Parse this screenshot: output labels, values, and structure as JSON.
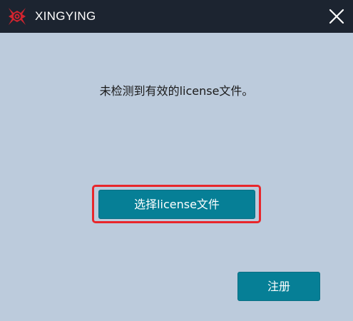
{
  "titlebar": {
    "app_title": "XINGYING",
    "logo_icon": "xingying-logo-icon",
    "close_icon": "close-icon",
    "background_color": "#1c2430"
  },
  "dialog": {
    "message": "未检测到有效的license文件。",
    "select_license_button": "选择license文件",
    "register_button": "注册",
    "accent_color": "#067f96",
    "highlight_color": "#e8262b",
    "background_color": "#bccbdc"
  }
}
